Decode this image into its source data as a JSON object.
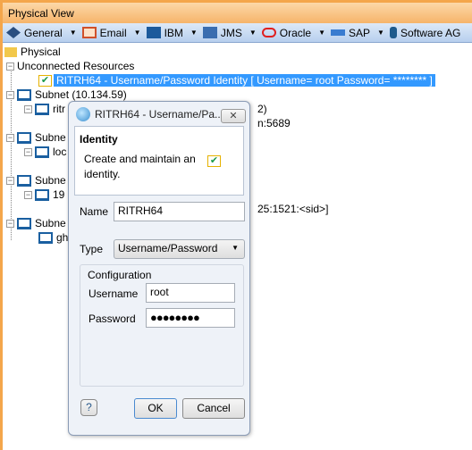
{
  "window": {
    "title": "Physical View"
  },
  "toolbar": {
    "items": [
      {
        "label": "General",
        "icon": "general-icon"
      },
      {
        "label": "Email",
        "icon": "email-icon"
      },
      {
        "label": "IBM",
        "icon": "ibm-icon"
      },
      {
        "label": "JMS",
        "icon": "jms-icon"
      },
      {
        "label": "Oracle",
        "icon": "oracle-icon"
      },
      {
        "label": "SAP",
        "icon": "sap-icon"
      },
      {
        "label": "Software AG",
        "icon": "software-ag-icon"
      }
    ]
  },
  "tree": {
    "root": "Physical",
    "unconnected": "Unconnected Resources",
    "selected": "RITRH64 - Username/Password Identity [ Username= root Password= ******** ]",
    "subnet1": "Subnet (10.134.59)",
    "host1": "ritr",
    "host1_suffix": "2)",
    "res1_suffix": "n:5689",
    "subnet2": "Subne",
    "host2": "loc",
    "subnet3": "Subne",
    "host3": "19",
    "res3_suffix": "25:1521:<sid>]",
    "subnet4": "Subne",
    "host4": "gh"
  },
  "dialog": {
    "title": "RITRH64 - Username/Pa...",
    "close": "✕",
    "header_title": "Identity",
    "header_desc": "Create and maintain an identity.",
    "name_label": "Name",
    "name_value": "RITRH64",
    "type_label": "Type",
    "type_value": "Username/Password",
    "group_label": "Configuration",
    "username_label": "Username",
    "username_value": "root",
    "password_label": "Password",
    "password_value": "●●●●●●●●",
    "help": "?",
    "ok": "OK",
    "cancel": "Cancel"
  }
}
